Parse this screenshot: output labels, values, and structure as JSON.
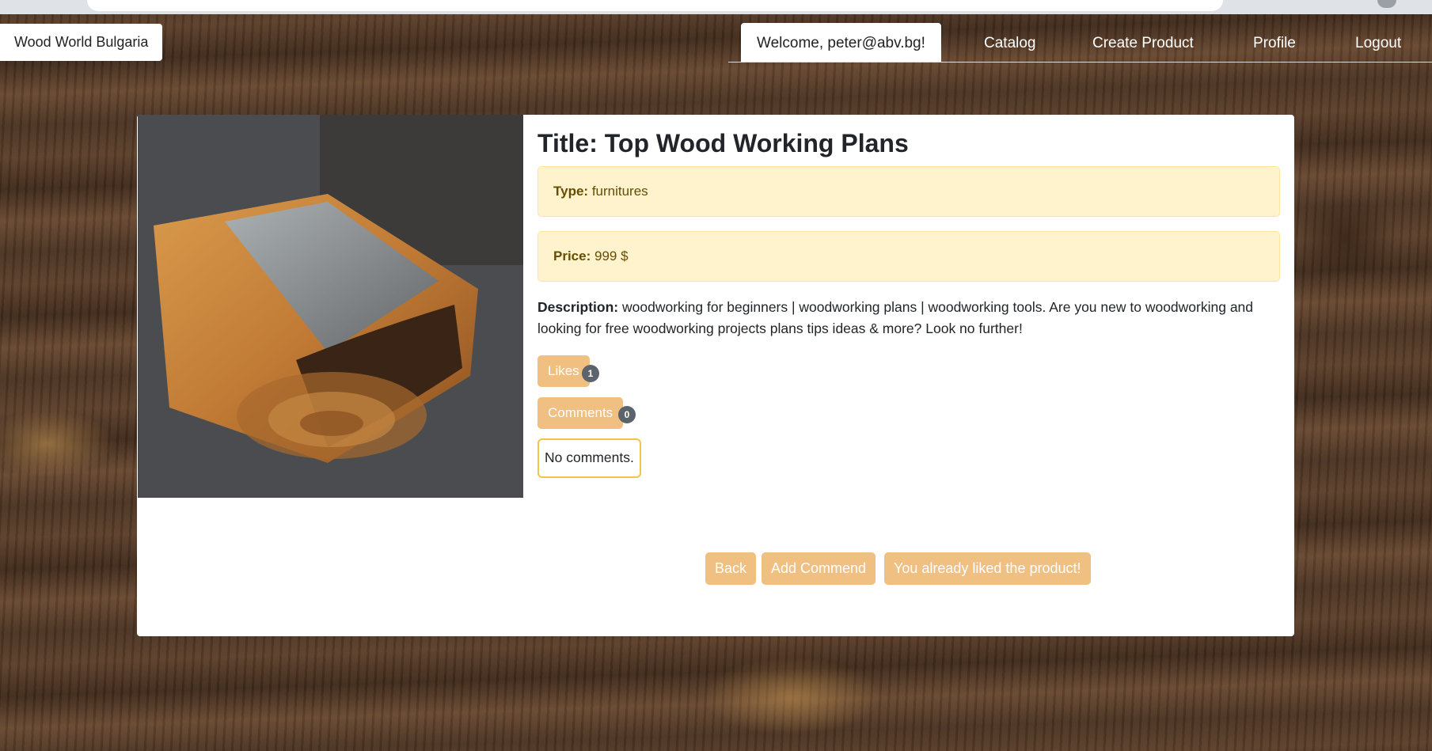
{
  "nav": {
    "brand": "Wood World Bulgaria",
    "welcome": "Welcome, peter@abv.bg!",
    "links": [
      "Catalog",
      "Create Product",
      "Profile",
      "Logout"
    ]
  },
  "product": {
    "title": "Title: Top Wood Working Plans",
    "type_label": "Type:",
    "type_value": "furnitures",
    "price_label": "Price:",
    "price_value": "999 $",
    "description_label": "Description:",
    "description_text": "woodworking for beginners | woodworking plans | woodworking tools. Are you new to woodworking and looking for free woodworking projects plans tips ideas & more? Look no further!",
    "likes_label": "Likes",
    "likes_count": "1",
    "comments_label": "Comments",
    "comments_count": "0",
    "no_comments": "No comments."
  },
  "actions": {
    "back": "Back",
    "add_comment": "Add Commend",
    "liked": "You already liked the product!"
  },
  "colors": {
    "accent_button": "#f0bf82",
    "alert_bg": "#fff3cd",
    "alert_text": "#664d03",
    "badge": "#5c636a"
  }
}
